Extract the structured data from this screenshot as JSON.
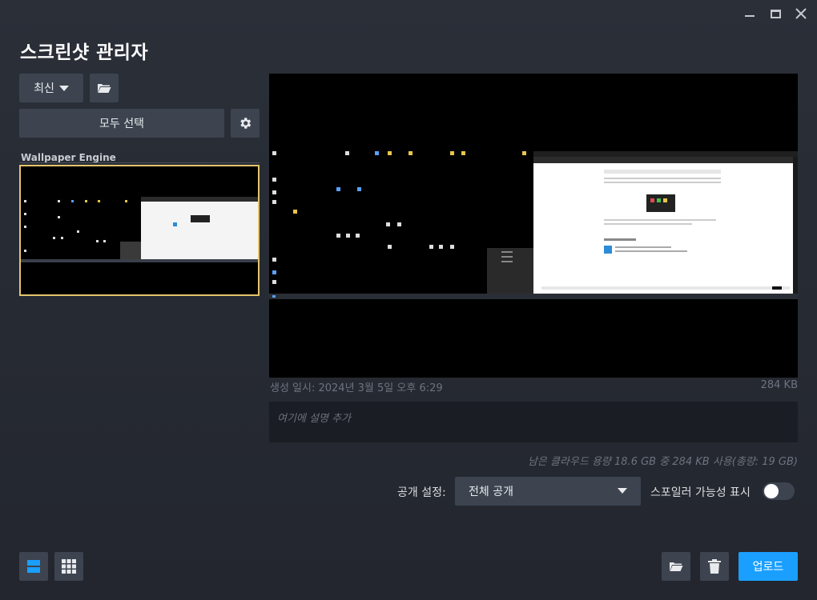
{
  "window": {
    "title": "스크린샷 관리자"
  },
  "toolbar": {
    "sort_label": "최신",
    "select_all_label": "모두 선택"
  },
  "library": {
    "group_label": "Wallpaper Engine"
  },
  "details": {
    "created_label": "생성 일시: 2024년 3월 5일 오후 6:29",
    "file_size": "284 KB",
    "description_placeholder": "여기에 설명 추가",
    "quota_text": "남은 클라우드 용량 18.6 GB 중 284 KB 사용(총량: 19 GB)"
  },
  "visibility": {
    "label": "공개 설정:",
    "selected": "전체 공개"
  },
  "spoiler": {
    "label": "스포일러 가능성 표시",
    "enabled": false
  },
  "actions": {
    "upload_label": "업로드"
  },
  "colors": {
    "accent_blue": "#1a9fff",
    "selected_border": "#e4c56b",
    "button_bg": "#3d4450",
    "window_bg": "#262a33"
  },
  "icons": [
    "minimize-icon",
    "maximize-icon",
    "close-icon",
    "folder-icon",
    "gear-icon",
    "list-view-icon",
    "grid-view-icon",
    "trash-icon"
  ]
}
